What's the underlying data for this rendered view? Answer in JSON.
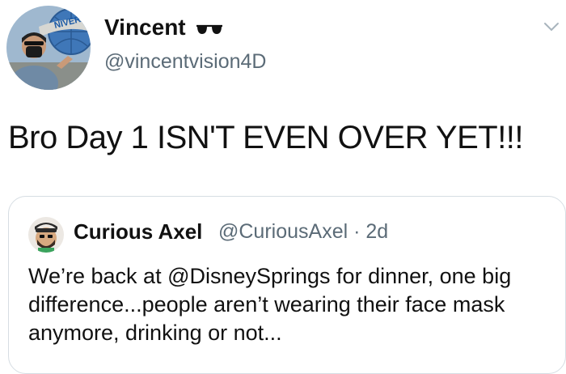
{
  "tweet": {
    "author": {
      "display_name": "Vincent",
      "name_emoji_icon": "sunglasses-icon",
      "handle": "@vincentvision4D"
    },
    "text": "Bro Day 1 ISN'T EVEN OVER YET!!!",
    "menu_icon": "chevron-down-icon"
  },
  "quoted_tweet": {
    "display_name": "Curious Axel",
    "meta": "@CuriousAxel · 2d",
    "text": "We’re back at @DisneySprings for dinner, one big difference...people aren’t wearing their face mask anymore, drinking or not..."
  },
  "colors": {
    "text": "#111111",
    "secondary": "#5b6b77",
    "border": "#d6dde3"
  }
}
